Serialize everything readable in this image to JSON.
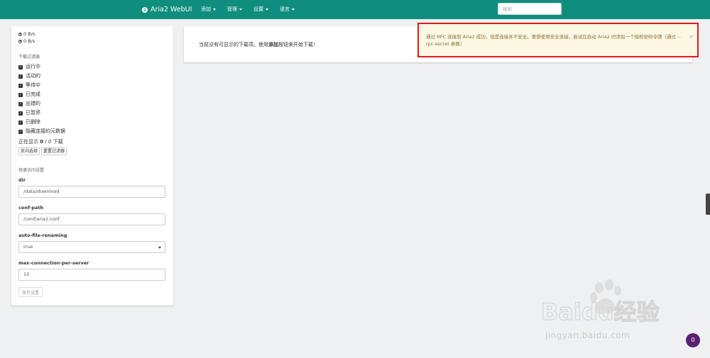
{
  "nav": {
    "brand": "Aria2 WebUI",
    "menu": [
      "添加",
      "管理",
      "设置",
      "语言"
    ],
    "search_placeholder": "搜索"
  },
  "sidebar": {
    "download_speed": "0 B/s",
    "upload_speed": "0 B/s",
    "filter_title": "下载过滤器",
    "filters": [
      "运行中",
      "活动的",
      "等待中",
      "已完成",
      "出错的",
      "已暂停",
      "已删除",
      "隐藏连接的元数据"
    ],
    "showing_prefix": "正在显示",
    "showing_count": "0",
    "showing_sep": "/",
    "showing_total": "0",
    "showing_suffix": "下载",
    "invert_button": "反向选择",
    "reset_button": "重置过滤器",
    "quick_title": "快速访问设置",
    "options": [
      {
        "label": "dir",
        "value": "/data/download"
      },
      {
        "label": "conf-path",
        "value": "/conf/aria2.conf"
      },
      {
        "label": "auto-file-renaming",
        "value": "true"
      },
      {
        "label": "max-connection-per-server",
        "value": "10"
      }
    ],
    "save_button": "保存设置"
  },
  "main": {
    "empty_prefix": "当前没有可显示的下载项。使用",
    "empty_bold": "添加",
    "empty_suffix": "按钮来开始下载！"
  },
  "alert": {
    "text": "通过 RPC 连接到 Aria2 成功，但是连接并不安全。要想使用安全连接，尝试在启动 Aria2 时添加一个授权密码令牌（通过 --rpc-secret 参数）",
    "close": "×"
  },
  "watermark": {
    "text": "Baidu经验",
    "url": "jingyan.baidu.com"
  },
  "badge": "0",
  "colors": {
    "navbar": "#0f8e7e",
    "alert_border": "#e21b1b",
    "alert_text": "#8a6d3b",
    "badge": "#5c2073"
  }
}
